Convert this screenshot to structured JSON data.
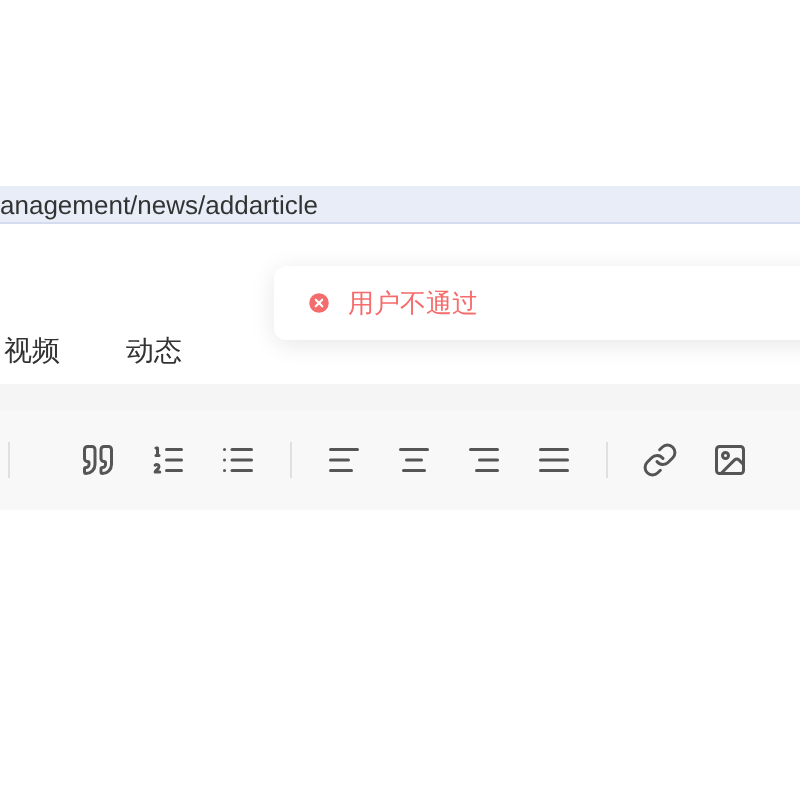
{
  "address_bar": {
    "url": "anagement/news/addarticle"
  },
  "tabs": [
    {
      "label": "视频",
      "selected": false
    },
    {
      "label": "动态",
      "selected": false
    }
  ],
  "toast": {
    "kind": "error",
    "message": "用户不通过"
  }
}
